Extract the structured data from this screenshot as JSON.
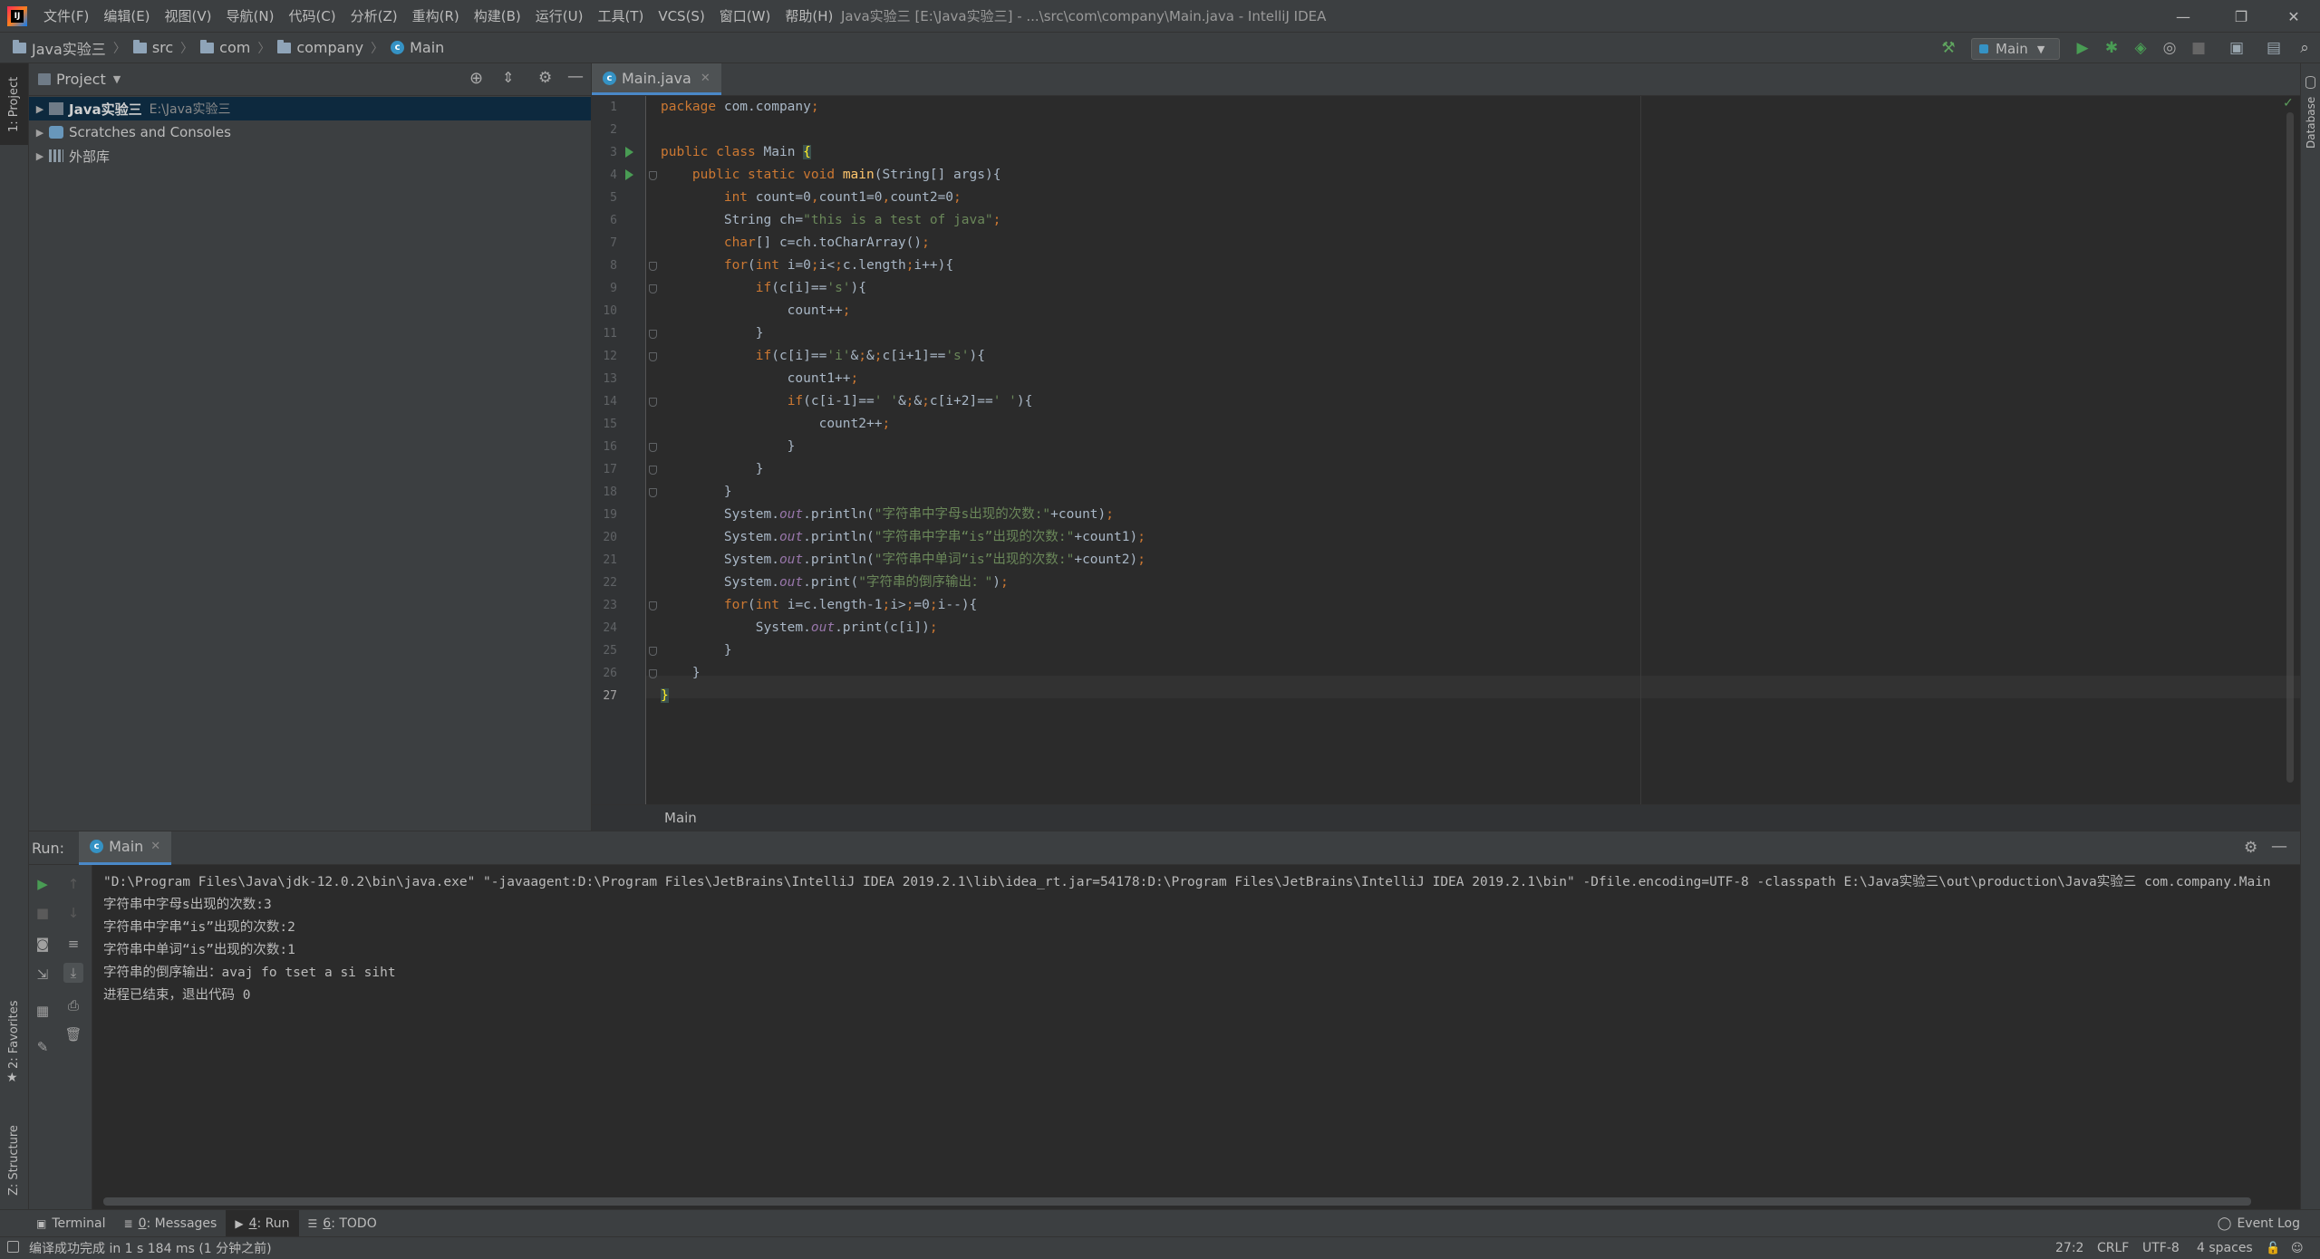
{
  "window": {
    "title": "Java实验三 [E:\\Java实验三] - ...\\src\\com\\company\\Main.java - IntelliJ IDEA",
    "logo": "IJ",
    "minimize_icon": "—",
    "restore_icon": "❐",
    "close_icon": "✕"
  },
  "menu": [
    "文件(F)",
    "编辑(E)",
    "视图(V)",
    "导航(N)",
    "代码(C)",
    "分析(Z)",
    "重构(R)",
    "构建(B)",
    "运行(U)",
    "工具(T)",
    "VCS(S)",
    "窗口(W)",
    "帮助(H)"
  ],
  "breadcrumbs": [
    "Java实验三",
    "src",
    "com",
    "company",
    "Main"
  ],
  "run_config": "Main",
  "left_stripe": {
    "project": "1: Project",
    "favorites": "2: Favorites",
    "structure": "Z: Structure"
  },
  "right_stripe": {
    "database": "Database"
  },
  "project": {
    "header": "Project",
    "tree": [
      {
        "label": "Java实验三",
        "sub": "E:\\Java实验三"
      },
      {
        "label": "Scratches and Consoles",
        "sub": ""
      },
      {
        "label": "外部库",
        "sub": ""
      }
    ]
  },
  "editor": {
    "tab": "Main.java",
    "breadcrumb": "Main",
    "line_numbers": [
      "1",
      "2",
      "3",
      "4",
      "5",
      "6",
      "7",
      "8",
      "9",
      "10",
      "11",
      "12",
      "13",
      "14",
      "15",
      "16",
      "17",
      "18",
      "19",
      "20",
      "21",
      "22",
      "23",
      "24",
      "25",
      "26",
      "27"
    ],
    "lines": [
      "package com.company;",
      "",
      "public class Main {",
      "    public static void main(String[] args){",
      "        int count=0,count1=0,count2=0;",
      "        String ch=\"this is a test of java\";",
      "        char[] c=ch.toCharArray();",
      "        for(int i=0;i<c.length;i++){",
      "            if(c[i]=='s'){",
      "                count++;",
      "            }",
      "            if(c[i]=='i'&&c[i+1]=='s'){",
      "                count1++;",
      "                if(c[i-1]==' '&&c[i+2]==' '){",
      "                    count2++;",
      "                }",
      "            }",
      "        }",
      "        System.out.println(\"字符串中字母s出现的次数:\"+count);",
      "        System.out.println(\"字符串中字串“is”出现的次数:\"+count1);",
      "        System.out.println(\"字符串中单词“is”出现的次数:\"+count2);",
      "        System.out.print(\"字符串的倒序输出：\");",
      "        for(int i=c.length-1;i>=0;i--){",
      "            System.out.print(c[i]);",
      "        }",
      "    }",
      "}"
    ]
  },
  "run": {
    "label": "Run:",
    "tab": "Main",
    "console": [
      "\"D:\\Program Files\\Java\\jdk-12.0.2\\bin\\java.exe\" \"-javaagent:D:\\Program Files\\JetBrains\\IntelliJ IDEA 2019.2.1\\lib\\idea_rt.jar=54178:D:\\Program Files\\JetBrains\\IntelliJ IDEA 2019.2.1\\bin\" -Dfile.encoding=UTF-8 -classpath E:\\Java实验三\\out\\production\\Java实验三 com.company.Main",
      "字符串中字母s出现的次数:3",
      "字符串中字串“is”出现的次数:2",
      "字符串中单词“is”出现的次数:1",
      "字符串的倒序输出：avaj fo tset a si siht",
      "进程已结束，退出代码 0"
    ]
  },
  "tool_buttons": {
    "terminal": "Terminal",
    "messages_num": "0",
    "messages": ": Messages",
    "run_num": "4",
    "run": ": Run",
    "todo_num": "6",
    "todo": ": TODO",
    "event_log": "Event Log"
  },
  "status": {
    "message": "编译成功完成 in 1 s 184 ms (1 分钟之前)",
    "position": "27:2",
    "line_sep": "CRLF",
    "encoding": "UTF-8",
    "indent": "4 spaces"
  },
  "colors": {
    "keyword": "#cc7832",
    "string": "#6a8759",
    "method": "#ffc66d",
    "static_field": "#9876aa",
    "run_green": "#499c54",
    "selection": "#0d293e"
  }
}
